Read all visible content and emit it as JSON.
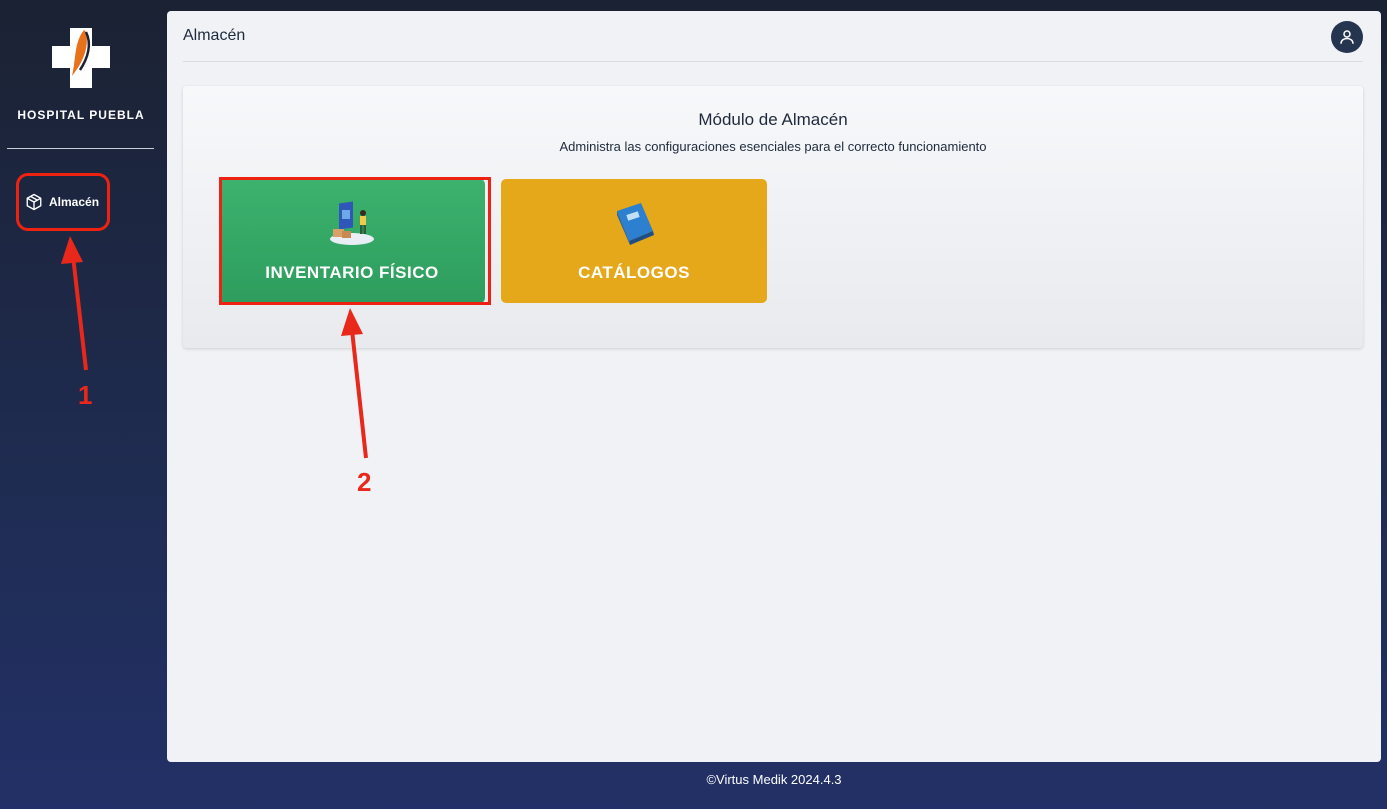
{
  "sidebar": {
    "brand_name": "HOSPITAL PUEBLA",
    "items": [
      {
        "label": "Almacén",
        "icon": "box-icon"
      }
    ]
  },
  "header": {
    "title": "Almacén",
    "avatar_icon": "user-icon"
  },
  "module": {
    "title": "Módulo de Almacén",
    "subtitle": "Administra las configuraciones esenciales para el correcto funcionamiento",
    "tiles": [
      {
        "label": "INVENTARIO FÍSICO",
        "icon": "inventory-illustration-icon",
        "color": "#34a866"
      },
      {
        "label": "CATÁLOGOS",
        "icon": "book-icon",
        "color": "#e4a81a"
      }
    ]
  },
  "footer": {
    "text": "©Virtus Medik 2024.4.3"
  },
  "annotations": {
    "step1": "1",
    "step2": "2",
    "color": "#e8281a"
  }
}
